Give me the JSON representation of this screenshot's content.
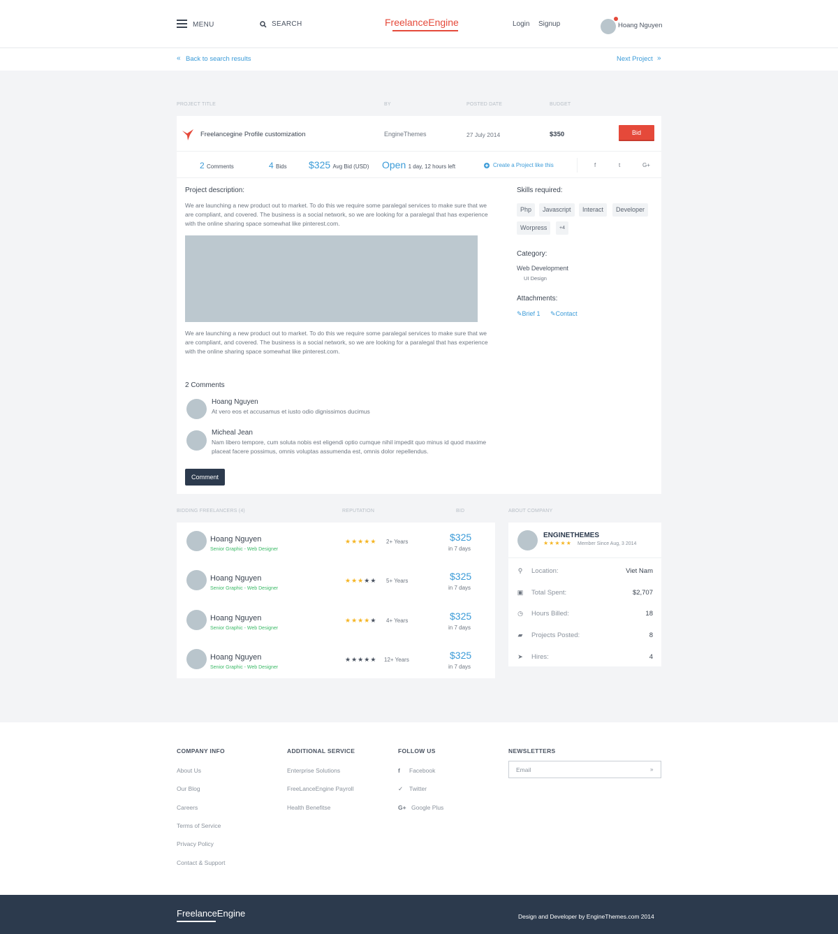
{
  "header": {
    "menu_label": "MENU",
    "search_label": "SEARCH",
    "logo": "FreelanceEngine",
    "login": "Login",
    "signup": "Signup",
    "user_name": "Hoang Nguyen"
  },
  "subnav": {
    "back_arrow": "«",
    "back": "Back to search results",
    "next": "Next Project",
    "next_arrow": "»"
  },
  "columns": {
    "project_title": "PROJECT TITLE",
    "by": "BY",
    "posted_date": "POSTED DATE",
    "budget": "BUDGET"
  },
  "project": {
    "title": "Freelancegine Profile customization",
    "by": "EngineThemes",
    "posted": "27 July 2014",
    "budget": "$350",
    "bid_button": "Bid",
    "comments_count": "2",
    "comments_label": "Comments",
    "bids_count": "4",
    "bids_label": "Bids",
    "avg_bid": "$325",
    "avg_bid_label": "Avg Bid (USD)",
    "status": "Open",
    "time_left": "1 day, 12 hours left",
    "create_like": "Create a Project like this",
    "social": [
      "f",
      "t",
      "G+"
    ]
  },
  "description": {
    "heading": "Project description:",
    "para1": "We are launching a new product out to market. To do this we require some paralegal services to make sure that we are compliant, and covered. The business is a social network, so we are looking for a paralegal that has experience with the online sharing space somewhat like pinterest.com.",
    "para2": "We are launching a new product out to market. To do this we require some paralegal services to make sure that we are compliant, and covered. The business is a social network, so we are looking for a paralegal that has experience with the online sharing space somewhat like pinterest.com."
  },
  "sidebar": {
    "skills_heading": "Skills required:",
    "skills": [
      "Php",
      "Javascript",
      "Interact",
      "Developer",
      "Worpress",
      "+4"
    ],
    "category_heading": "Category:",
    "category": "Web Development",
    "subcategory": "UI Design",
    "attachments_heading": "Attachments:",
    "attachments": [
      "Brief 1",
      "Contact"
    ]
  },
  "comments": {
    "heading": "2 Comments",
    "items": [
      {
        "name": "Hoang Nguyen",
        "text": "At vero eos et accusamus et iusto odio dignissimos ducimus"
      },
      {
        "name": "Micheal Jean",
        "text": "Nam libero tempore, cum soluta nobis est eligendi optio cumque nihil impedit quo minus id quod maxime placeat facere possimus, omnis voluptas assumenda est, omnis dolor repellendus."
      }
    ],
    "button": "Comment"
  },
  "bidders_columns": {
    "freelancers": "BIDDING FREELANCERS (4)",
    "reputation": "REPUTATION",
    "bid": "BID",
    "about": "ABOUT COMPANY"
  },
  "bidders": [
    {
      "name": "Hoang Nguyen",
      "role": "Senior Graphic - Web Designer",
      "stars": 5,
      "years": "2+ Years",
      "price": "$325",
      "days": "in 7 days"
    },
    {
      "name": "Hoang Nguyen",
      "role": "Senior Graphic - Web Designer",
      "stars": 3,
      "years": "5+ Years",
      "price": "$325",
      "days": "in 7 days"
    },
    {
      "name": "Hoang Nguyen",
      "role": "Senior Graphic - Web Designer",
      "stars": 4,
      "years": "4+ Years",
      "price": "$325",
      "days": "in 7 days"
    },
    {
      "name": "Hoang Nguyen",
      "role": "Senior Graphic - Web Designer",
      "stars": 0,
      "years": "12+ Years",
      "price": "$325",
      "days": "in 7 days"
    }
  ],
  "company": {
    "name": "ENGINETHEMES",
    "since": "Member Since Aug, 3 2014",
    "rows": [
      {
        "icon": "location-icon",
        "label": "Location:",
        "value": "Viet Nam"
      },
      {
        "icon": "money-icon",
        "label": "Total Spent:",
        "value": "$2,707"
      },
      {
        "icon": "clock-icon",
        "label": "Hours Billed:",
        "value": "18"
      },
      {
        "icon": "briefcase-icon",
        "label": "Projects Posted:",
        "value": "8"
      },
      {
        "icon": "send-icon",
        "label": "Hires:",
        "value": "4"
      }
    ]
  },
  "footer": {
    "company_info": "COMPANY INFO",
    "company_links": [
      "About Us",
      "Our Blog",
      "Careers",
      "Terms of Service",
      "Privacy Policy",
      "Contact & Support"
    ],
    "additional": "ADDITIONAL SERVICE",
    "additional_links": [
      "Enterprise Solutions",
      "FreeLanceEngine Payroll",
      "Health Benefitse"
    ],
    "follow": "FOLLOW US",
    "follow_links": [
      "Facebook",
      "Twitter",
      "Google Plus"
    ],
    "newsletters": "NEWSLETTERS",
    "email_placeholder": "Email",
    "bottom_logo": "FreelanceEngine",
    "credit": "Design and Developer by EngineThemes.com 2014"
  },
  "colors": {
    "accent": "#e5493a",
    "link": "#3b9bd8",
    "dark": "#2c3a4d",
    "green": "#3cba67",
    "star": "#f5b523"
  }
}
